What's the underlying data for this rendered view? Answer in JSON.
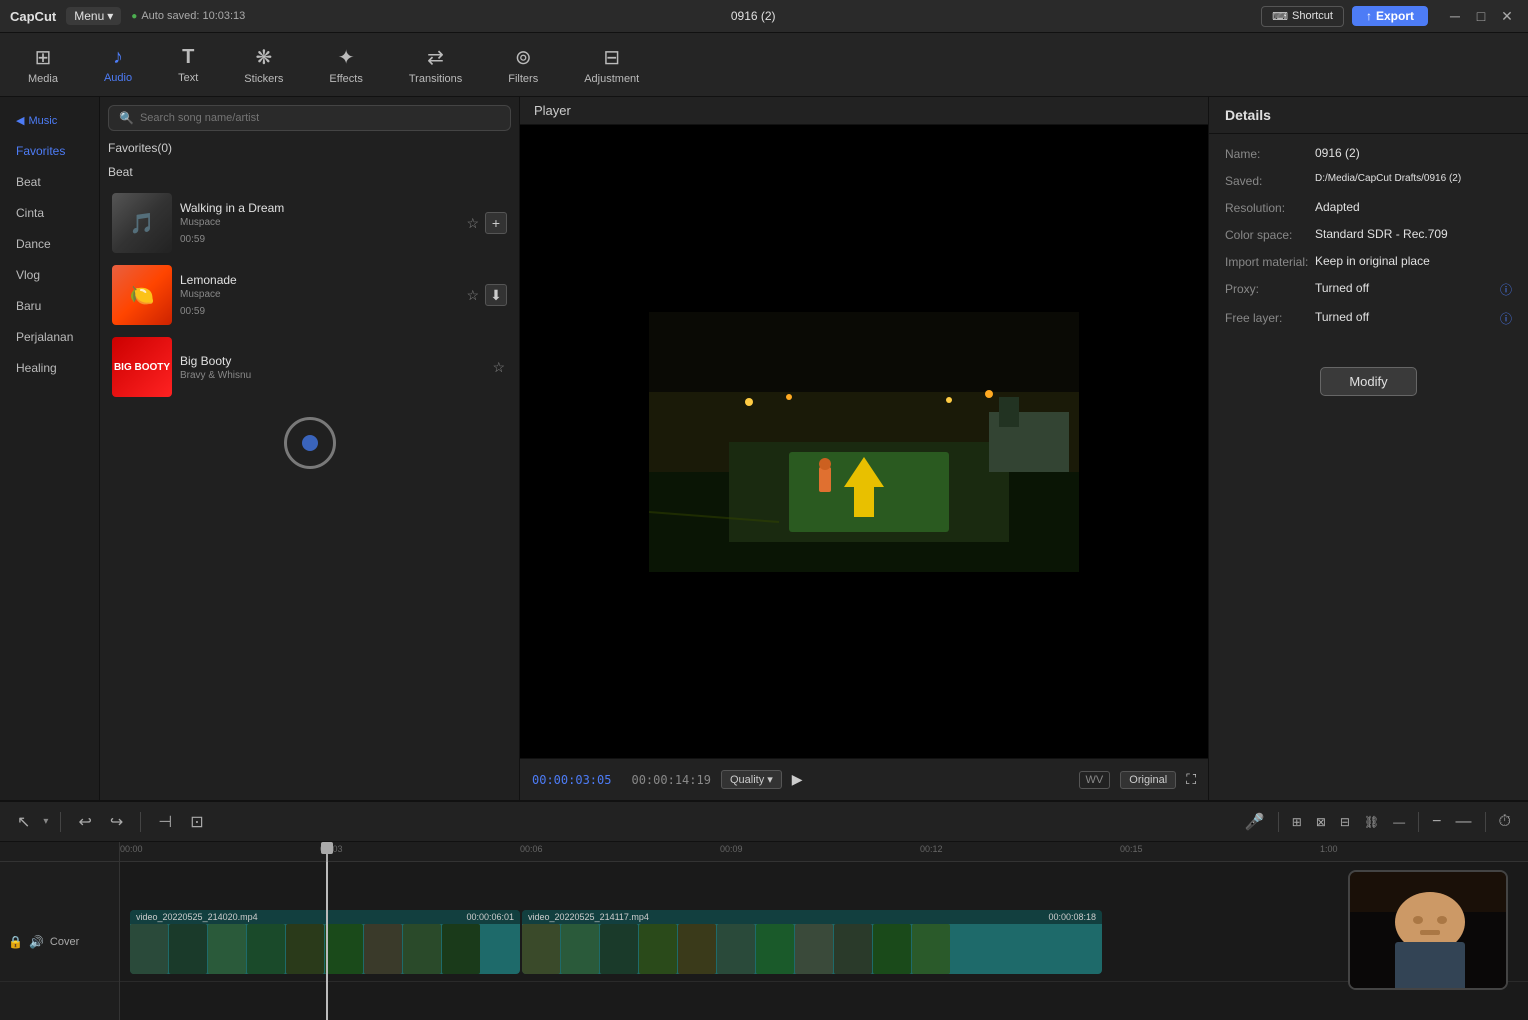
{
  "app": {
    "name": "CapCut",
    "menu_label": "Menu",
    "auto_saved": "Auto saved: 10:03:13",
    "project_title": "0916 (2)"
  },
  "topbar": {
    "shortcut_label": "Shortcut",
    "export_label": "Export"
  },
  "toolbar": {
    "items": [
      {
        "id": "media",
        "label": "Media",
        "icon": "⊞"
      },
      {
        "id": "audio",
        "label": "Audio",
        "icon": "♪"
      },
      {
        "id": "text",
        "label": "Text",
        "icon": "T"
      },
      {
        "id": "stickers",
        "label": "Stickers",
        "icon": "★"
      },
      {
        "id": "effects",
        "label": "Effects",
        "icon": "✦"
      },
      {
        "id": "transitions",
        "label": "Transitions",
        "icon": "⇄"
      },
      {
        "id": "filters",
        "label": "Filters",
        "icon": "⊚"
      },
      {
        "id": "adjustment",
        "label": "Adjustment",
        "icon": "⊟"
      }
    ],
    "active": "audio"
  },
  "sidebar": {
    "section_label": "Music",
    "items": [
      {
        "id": "favorites",
        "label": "Favorites"
      },
      {
        "id": "beat",
        "label": "Beat"
      },
      {
        "id": "cinta",
        "label": "Cinta"
      },
      {
        "id": "dance",
        "label": "Dance"
      },
      {
        "id": "vlog",
        "label": "Vlog"
      },
      {
        "id": "baru",
        "label": "Baru"
      },
      {
        "id": "perjalanan",
        "label": "Perjalanan"
      },
      {
        "id": "healing",
        "label": "Healing"
      }
    ],
    "active": "favorites"
  },
  "music_panel": {
    "search_placeholder": "Search song name/artist",
    "favorites_title": "Favorites(0)",
    "beat_title": "Beat",
    "songs": [
      {
        "id": "song1",
        "title": "Walking in a Dream",
        "artist": "Muspace",
        "duration": "00:59",
        "thumb_color1": "#444",
        "thumb_color2": "#666"
      },
      {
        "id": "song2",
        "title": "Lemonade",
        "artist": "Muspace",
        "duration": "00:59",
        "thumb_color1": "#e86040",
        "thumb_color2": "#ff8c00"
      },
      {
        "id": "song3",
        "title": "Big Booty",
        "artist": "Bravy & Whisnu",
        "duration": "",
        "thumb_color1": "#cc0000",
        "thumb_color2": "#ff4444"
      }
    ]
  },
  "player": {
    "title": "Player",
    "time_current": "00:00:03:05",
    "time_total": "00:00:14:19",
    "quality_label": "Quality",
    "original_label": "Original",
    "wv_label": "WV"
  },
  "details": {
    "title": "Details",
    "fields": [
      {
        "label": "Name:",
        "value": "0916 (2)"
      },
      {
        "label": "Saved:",
        "value": "D:/Media/CapCut Drafts/0916 (2)"
      },
      {
        "label": "Resolution:",
        "value": "Adapted"
      },
      {
        "label": "Color space:",
        "value": "Standard SDR - Rec.709"
      },
      {
        "label": "Import material:",
        "value": "Keep in original place"
      },
      {
        "label": "Proxy:",
        "value": "Turned off"
      },
      {
        "label": "Free layer:",
        "value": "Turned off"
      }
    ],
    "modify_label": "Modify"
  },
  "timeline": {
    "cover_label": "Cover",
    "clips": [
      {
        "filename": "video_20220525_214020.mp4",
        "duration": "00:00:06:01"
      },
      {
        "filename": "video_20220525_214117.mp4",
        "duration": "00:00:08:18"
      }
    ],
    "ruler_marks": [
      "00:00",
      "00:03",
      "00:06",
      "00:09",
      "00:12",
      "00:15",
      "1:00"
    ],
    "playhead_position": "00:03"
  },
  "icons": {
    "search": "🔍",
    "music": "♪",
    "star": "☆",
    "star_filled": "★",
    "download": "⬇",
    "plus": "+",
    "play": "▶",
    "undo": "↩",
    "redo": "↪",
    "split": "⊣",
    "select": "↖",
    "mic": "🎤",
    "zoom_in": "+",
    "zoom_out": "−",
    "minus_line": "—",
    "shortcut_icon": "⌨",
    "export_icon": "↑",
    "minimize": "─",
    "maximize": "□",
    "close": "✕",
    "chevron_down": "▾",
    "info": "ⓘ",
    "lock": "🔒",
    "volume": "🔊",
    "link": "⛓",
    "unlink": "⛓",
    "crop": "⊡",
    "timer": "⏱",
    "clock": "⏰"
  }
}
